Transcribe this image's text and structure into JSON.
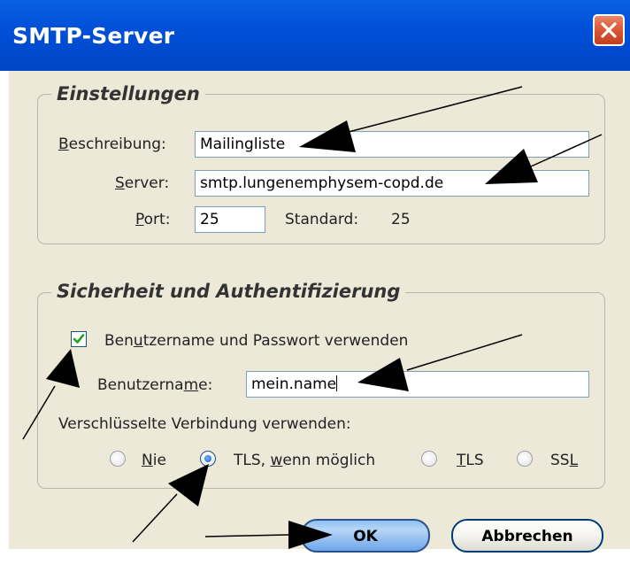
{
  "window": {
    "title": "SMTP-Server"
  },
  "settings": {
    "legend": "Einstellungen",
    "description_label": "Beschreibung:",
    "description_value": "Mailingliste",
    "server_label": "Server:",
    "server_value": "smtp.lungenemphysem-copd.de",
    "port_label": "Port:",
    "port_value": "25",
    "default_label": "Standard:",
    "default_value": "25"
  },
  "security": {
    "legend": "Sicherheit und Authentifizierung",
    "use_credentials_label": "Benutzername und Passwort verwenden",
    "use_credentials_checked": true,
    "username_label": "Benutzername:",
    "username_value": "mein.name",
    "encryption_label": "Verschlüsselte Verbindung verwenden:",
    "encryption_options": [
      "Nie",
      "TLS, wenn möglich",
      "TLS",
      "SSL"
    ],
    "encryption_selected": "TLS, wenn möglich"
  },
  "buttons": {
    "ok_label": "OK",
    "cancel_label": "Abbrechen"
  },
  "icons": {
    "close": "close-icon",
    "checkmark": "checkmark-icon"
  },
  "colors": {
    "titlebar": "#0050d8",
    "dialog_bg": "#ece9d8",
    "close_button": "#d8532f",
    "ok_button": "#8fc0f4"
  }
}
